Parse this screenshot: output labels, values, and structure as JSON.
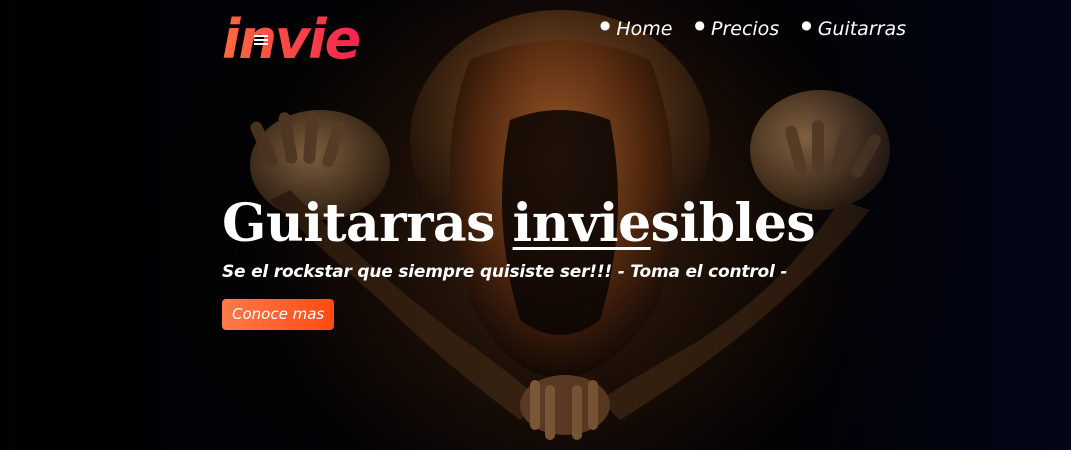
{
  "header": {
    "logo_text": "invie",
    "nav": [
      {
        "label": "Home"
      },
      {
        "label": "Precios"
      },
      {
        "label": "Guitarras"
      }
    ]
  },
  "hero": {
    "title_part1": "Guitarras ",
    "title_underlined": "invie",
    "title_part2": "sibles",
    "subtitle": "Se el rockstar que siempre quisiste ser!!! - Toma el control -",
    "cta_label": "Conoce mas"
  },
  "colors": {
    "logo_gradient_start": "#ff6a3d",
    "logo_gradient_end": "#f5244f",
    "cta_start": "#ff7a4a",
    "cta_end": "#ff4a12"
  },
  "icons": {
    "nav_bullet": "bullet-dot-icon"
  }
}
